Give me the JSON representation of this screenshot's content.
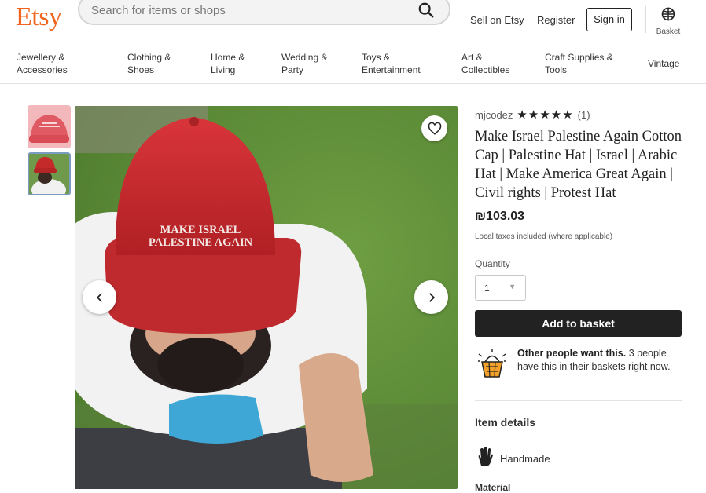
{
  "header": {
    "logo": "Etsy",
    "search_placeholder": "Search for items or shops",
    "sell_link": "Sell on Etsy",
    "register_link": "Register",
    "signin_label": "Sign in",
    "basket_label": "Basket"
  },
  "categories": [
    {
      "line1": "Jewellery &",
      "line2": "Accessories"
    },
    {
      "line1": "Clothing &",
      "line2": "Shoes"
    },
    {
      "line1": "Home &",
      "line2": "Living"
    },
    {
      "line1": "Wedding &",
      "line2": "Party"
    },
    {
      "line1": "Toys &",
      "line2": "Entertainment"
    },
    {
      "line1": "Art &",
      "line2": "Collectibles"
    },
    {
      "line1": "Craft Supplies &",
      "line2": "Tools"
    },
    {
      "line1": "Vintage",
      "line2": ""
    }
  ],
  "product": {
    "image_text_line1": "MAKE ISRAEL",
    "image_text_line2": "PALESTINE AGAIN",
    "seller": "mjcodez",
    "stars": "★★★★★",
    "review_count": "(1)",
    "title": "Make Israel Palestine Again Cotton Cap | Palestine Hat | Israel | Arabic Hat | Make America Great Again | Civil rights | Protest Hat",
    "price": "₪103.03",
    "tax_note": "Local taxes included (where applicable)",
    "quantity_label": "Quantity",
    "quantity_value": "1",
    "add_to_basket": "Add to basket",
    "demand_bold": "Other people want this.",
    "demand_text": " 3 people have this in their baskets right now.",
    "item_details_heading": "Item details",
    "handmade_label": "Handmade",
    "material_heading": "Material"
  },
  "colors": {
    "brand": "#F1641E",
    "button_dark": "#222222",
    "hat_red": "#C42A2A"
  }
}
